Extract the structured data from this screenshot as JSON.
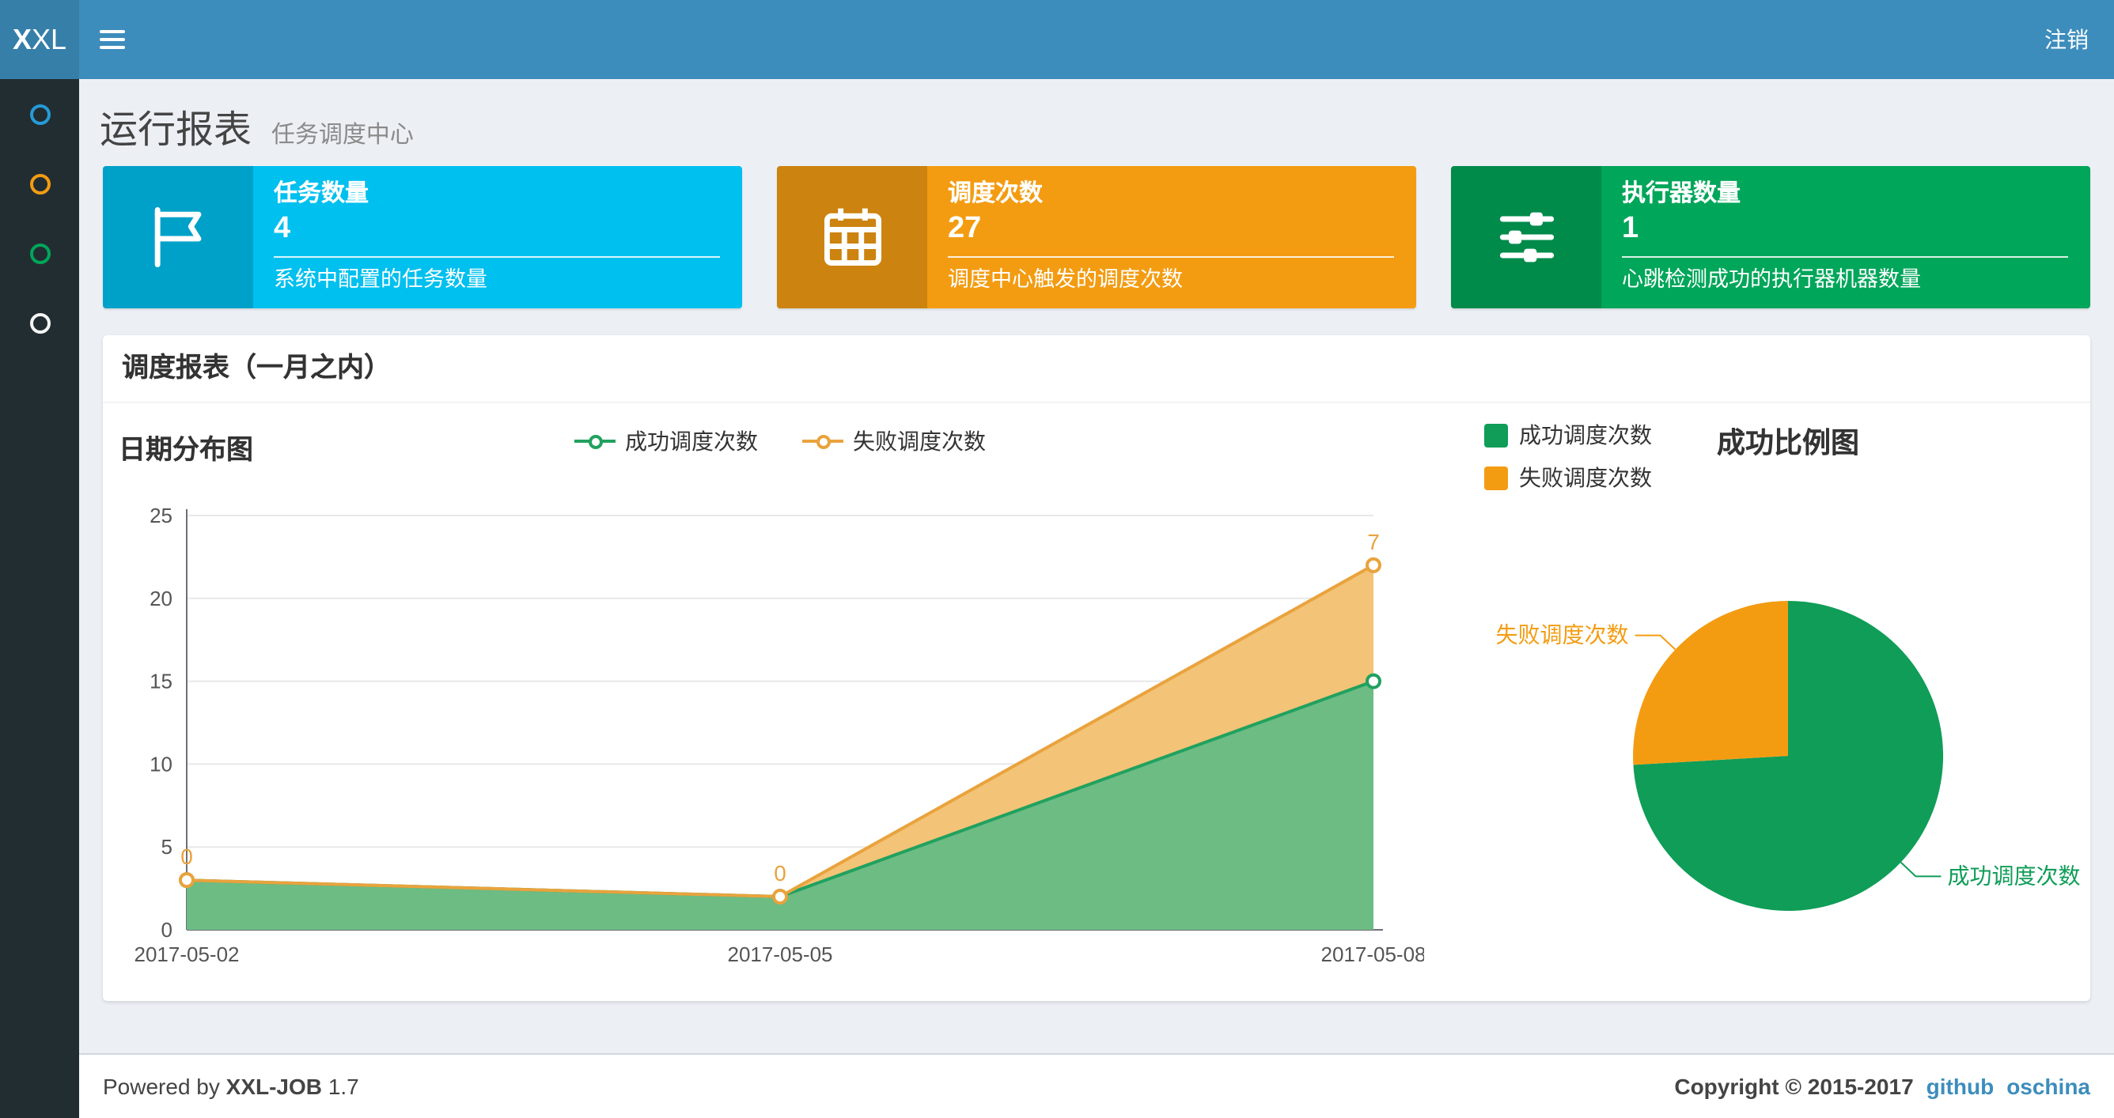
{
  "navbar": {
    "logo_bold": "X",
    "logo_rest": "XL",
    "logout_label": "注销"
  },
  "header": {
    "title": "运行报表",
    "subtitle": "任务调度中心"
  },
  "sidebar": {
    "items": [
      {
        "id": "menu-1",
        "color": "#269bd8"
      },
      {
        "id": "menu-2",
        "color": "#f39c12"
      },
      {
        "id": "menu-3",
        "color": "#00a65a"
      },
      {
        "id": "menu-4",
        "color": "#f5f5f5"
      }
    ]
  },
  "info_boxes": [
    {
      "title": "任务数量",
      "value": "4",
      "desc": "系统中配置的任务数量",
      "bg": "#00c0ef",
      "icon": "flag-icon"
    },
    {
      "title": "调度次数",
      "value": "27",
      "desc": "调度中心触发的调度次数",
      "bg": "#f39c12",
      "icon": "calendar-icon"
    },
    {
      "title": "执行器数量",
      "value": "1",
      "desc": "心跳检测成功的执行器机器数量",
      "bg": "#00a65a",
      "icon": "sliders-icon"
    }
  ],
  "panel": {
    "title": "调度报表（一月之内）"
  },
  "chart_data": [
    {
      "type": "area",
      "title": "日期分布图",
      "categories": [
        "2017-05-02",
        "2017-05-05",
        "2017-05-08"
      ],
      "stacked": true,
      "series": [
        {
          "name": "成功调度次数",
          "values": [
            3,
            2,
            15
          ],
          "color": "#21a15f",
          "fill": "#6cbc84"
        },
        {
          "name": "失败调度次数",
          "values": [
            0,
            0,
            7
          ],
          "color": "#e9a33d",
          "fill": "#f3c377"
        }
      ],
      "point_labels": {
        "series": "失败调度次数",
        "values": [
          "0",
          "0",
          "7"
        ]
      },
      "ylim": [
        0,
        25
      ],
      "yticks": [
        0,
        5,
        10,
        15,
        20,
        25
      ],
      "grid": true,
      "legend_position": "top-center"
    },
    {
      "type": "pie",
      "title": "成功比例图",
      "slices": [
        {
          "name": "成功调度次数",
          "value": 20,
          "color": "#0f9d58"
        },
        {
          "name": "失败调度次数",
          "value": 7,
          "color": "#f39c12"
        }
      ],
      "legend_position": "top-left"
    }
  ],
  "footer": {
    "powered_prefix": "Powered by",
    "brand": "XXL-JOB",
    "version": "1.7",
    "copyright": "Copyright © 2015-2017",
    "links": [
      {
        "label": "github"
      },
      {
        "label": "oschina"
      }
    ]
  }
}
